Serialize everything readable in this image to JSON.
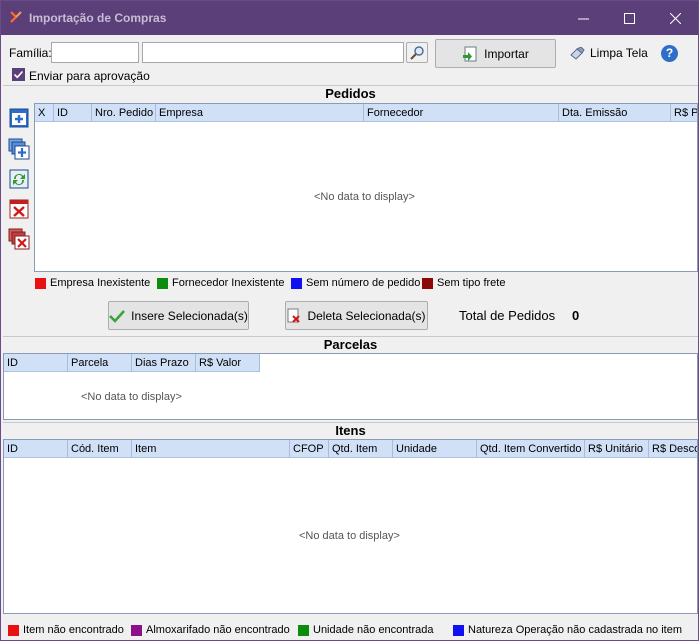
{
  "window": {
    "title": "Importação de Compras"
  },
  "toolbar": {
    "familia_label": "Família:",
    "familia_code_value": "",
    "familia_desc_value": "",
    "importar_label": "Importar",
    "limpa_tela_label": "Limpa Tela",
    "enviar_aprovacao_label": "Enviar para aprovação",
    "enviar_aprovacao_checked": true
  },
  "pedidos": {
    "title": "Pedidos",
    "columns": [
      "X",
      "ID",
      "Nro. Pedido",
      "Empresa",
      "Fornecedor",
      "Dta. Emissão",
      "R$ Pe"
    ],
    "empty_text": "<No data to display>",
    "legend": [
      {
        "label": "Empresa Inexistente",
        "color": "#e81010"
      },
      {
        "label": "Fornecedor Inexistente",
        "color": "#0c8c0c"
      },
      {
        "label": "Sem número de pedido",
        "color": "#1010f0"
      },
      {
        "label": "Sem tipo frete",
        "color": "#8c0808"
      }
    ],
    "insere_label": "Insere Selecionada(s)",
    "deleta_label": "Deleta Selecionada(s)",
    "total_label": "Total de Pedidos",
    "total_value": "0"
  },
  "parcelas": {
    "title": "Parcelas",
    "columns": [
      "ID",
      "Parcela",
      "Dias Prazo",
      "R$ Valor"
    ],
    "empty_text": "<No data to display>"
  },
  "itens": {
    "title": "Itens",
    "columns": [
      "ID",
      "Cód. Item",
      "Item",
      "CFOP",
      "Qtd. Item",
      "Unidade",
      "Qtd. Item Convertido",
      "R$ Unitário",
      "R$ Desco"
    ],
    "empty_text": "<No data to display>",
    "legend": [
      {
        "label": "Item não encontrado",
        "color": "#e81010"
      },
      {
        "label": "Almoxarifado não encontrado",
        "color": "#8c108c"
      },
      {
        "label": "Unidade não encontrada",
        "color": "#0c8c0c"
      },
      {
        "label": "Natureza Operação não cadastrada no item",
        "color": "#1010f0"
      }
    ]
  },
  "icons": {
    "app": "app-logo-icon",
    "search": "search-icon",
    "importar": "import-icon",
    "limpa_tela": "eraser-icon",
    "help": "help-icon"
  }
}
